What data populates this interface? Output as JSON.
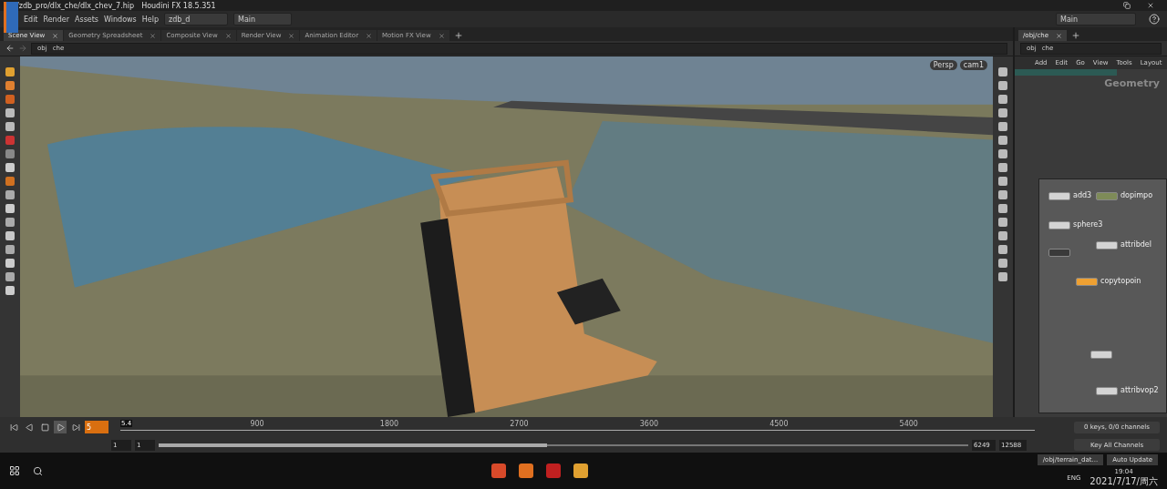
{
  "window": {
    "path": "/zdb_pro/dlx_che/dlx_chev_7.hip",
    "title": "Houdini FX 18.5.351"
  },
  "menu": [
    "Edit",
    "Render",
    "Assets",
    "Windows",
    "Help"
  ],
  "desktop": "zdb_d",
  "context": "Main",
  "right_context": "Main",
  "tabs": [
    {
      "label": "Scene View",
      "selected": true
    },
    {
      "label": "Geometry Spreadsheet",
      "selected": false
    },
    {
      "label": "Composite View",
      "selected": false
    },
    {
      "label": "Render View",
      "selected": false
    },
    {
      "label": "Animation Editor",
      "selected": false
    },
    {
      "label": "Motion FX View",
      "selected": false
    }
  ],
  "path": [
    "obj",
    "che"
  ],
  "viewport": {
    "camera": "Persp",
    "cam": "cam1"
  },
  "network": {
    "tab": "/obj/che",
    "path": [
      "obj",
      "che"
    ],
    "menu": [
      "Add",
      "Edit",
      "Go",
      "View",
      "Tools",
      "Layout"
    ],
    "context_label": "Geometry",
    "activity": {
      "level": 0.67
    },
    "nodes": [
      {
        "name": "add3",
        "color": "#d4d4d4"
      },
      {
        "name": "dopimpo",
        "color": "#7e8b58"
      },
      {
        "name": "sphere3",
        "color": "#d4d4d4"
      },
      {
        "name": "attribdel",
        "color": "#d4d4d4"
      },
      {
        "color": "#3a3a3a"
      },
      {
        "name": "copytopoin",
        "color": "#eea032"
      },
      {
        "color": "#d4d4d4"
      },
      {
        "name": "attribvop2",
        "color": "#d4d4d4"
      }
    ]
  },
  "timeline": {
    "frame": "5",
    "cursor": "5.4",
    "ticks": [
      "900",
      "1800",
      "2700",
      "3600",
      "4500",
      "5400"
    ],
    "keys": "0 keys, 0/0 channels",
    "key_all": "Key All Channels"
  },
  "range": {
    "level": 0.48,
    "start": "1",
    "current": "1",
    "end": "6249",
    "total": "12588"
  },
  "taskbar": {
    "node_path": "/obj/terrain_dat...",
    "update": "Auto Update",
    "lang": "ENG",
    "time": "19:04",
    "date": "2021/7/17/周六"
  }
}
